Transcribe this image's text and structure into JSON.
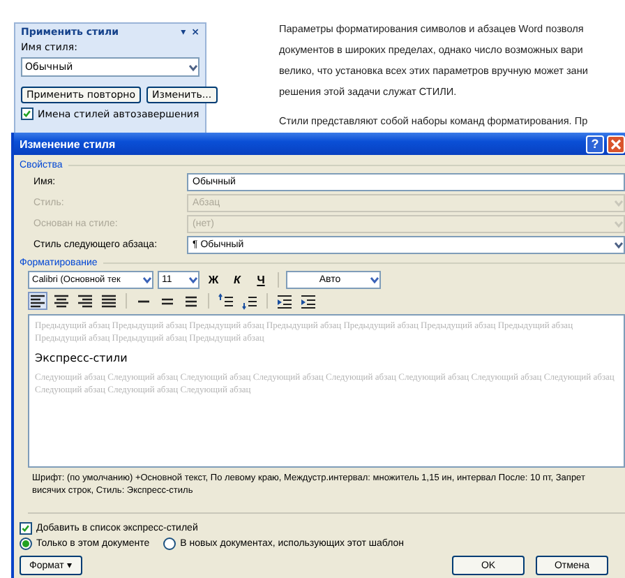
{
  "styles_pane": {
    "title": "Применить стили",
    "menu_glyph": "▾",
    "close_glyph": "×",
    "name_label": "Имя стиля:",
    "name_value": "Обычный",
    "buttons": [
      "Применить повторно",
      "Изменить..."
    ],
    "autocomplete": {
      "label": "Имена стилей автозавершения",
      "checked": true
    }
  },
  "document": {
    "paragraphs": [
      {
        "lines": [
          "Параметры форматирования символов и абзацев Word позволя",
          "документов в широких пределах, однако число возможных вари",
          "велико, что установка всех этих параметров вручную может зани",
          "решения этой задачи служат СТИЛИ."
        ]
      },
      {
        "lines": [
          "Стили представляют собой наборы команд форматирования. Пр"
        ]
      }
    ]
  },
  "dialog": {
    "title": "Изменение стиля",
    "help_glyph": "?",
    "properties": {
      "legend": "Свойства",
      "rows": [
        {
          "label": "Имя:",
          "value": "Обычный",
          "kind": "text",
          "disabled": false
        },
        {
          "label": "Стиль:",
          "value": "Абзац",
          "kind": "combo",
          "disabled": true
        },
        {
          "label": "Основан на стиле:",
          "value": "(нет)",
          "kind": "combo",
          "disabled": true
        },
        {
          "label": "Стиль следующего абзаца:",
          "value": "¶ Обычный",
          "kind": "combo",
          "disabled": false
        }
      ]
    },
    "formatting": {
      "legend": "Форматирование",
      "font": "Calibri (Основной тек",
      "size": "11",
      "text_styles": [
        {
          "text": "Ж",
          "kind": "bold"
        },
        {
          "text": "К",
          "kind": "italic"
        },
        {
          "text": "Ч",
          "kind": "underline"
        }
      ],
      "font_color": "Авто",
      "paragraph_tools": [
        {
          "kind": "align-left",
          "selected": true
        },
        {
          "kind": "align-center",
          "selected": false
        },
        {
          "kind": "align-right",
          "selected": false
        },
        {
          "kind": "justify",
          "selected": false
        },
        {
          "kind": "single",
          "selected": false
        },
        {
          "kind": "onehalf",
          "selected": false
        },
        {
          "kind": "double",
          "selected": false
        },
        {
          "kind": "space-before",
          "selected": false
        },
        {
          "kind": "space-after",
          "selected": false
        },
        {
          "kind": "outdent",
          "selected": false
        },
        {
          "kind": "indent",
          "selected": false
        }
      ]
    },
    "preview": {
      "previous": "Предыдущий абзац Предыдущий абзац Предыдущий абзац Предыдущий абзац Предыдущий абзац Предыдущий абзац Предыдущий абзац Предыдущий абзац Предыдущий абзац Предыдущий абзац",
      "sample": "Экспресс-стили",
      "next": "Следующий абзац Следующий абзац Следующий абзац Следующий абзац Следующий абзац Следующий абзац Следующий абзац Следующий абзац Следующий абзац Следующий абзац Следующий абзац"
    },
    "description": "Шрифт: (по умолчанию) +Основной текст, По левому краю, Междустр.интервал:  множитель 1,15 ин, интервал После:  10 пт, Запрет висячих строк, Стиль: Экспресс-стиль",
    "add_to_quick": {
      "label": "Добавить в список экспресс-стилей",
      "checked": true
    },
    "scope": [
      {
        "label": "Только в этом документе",
        "selected": true
      },
      {
        "label": "В новых документах, использующих этот шаблон",
        "selected": false
      }
    ],
    "format_button": {
      "label": "Формат",
      "caret": "▾"
    },
    "buttons": [
      "OK",
      "Отмена"
    ]
  }
}
